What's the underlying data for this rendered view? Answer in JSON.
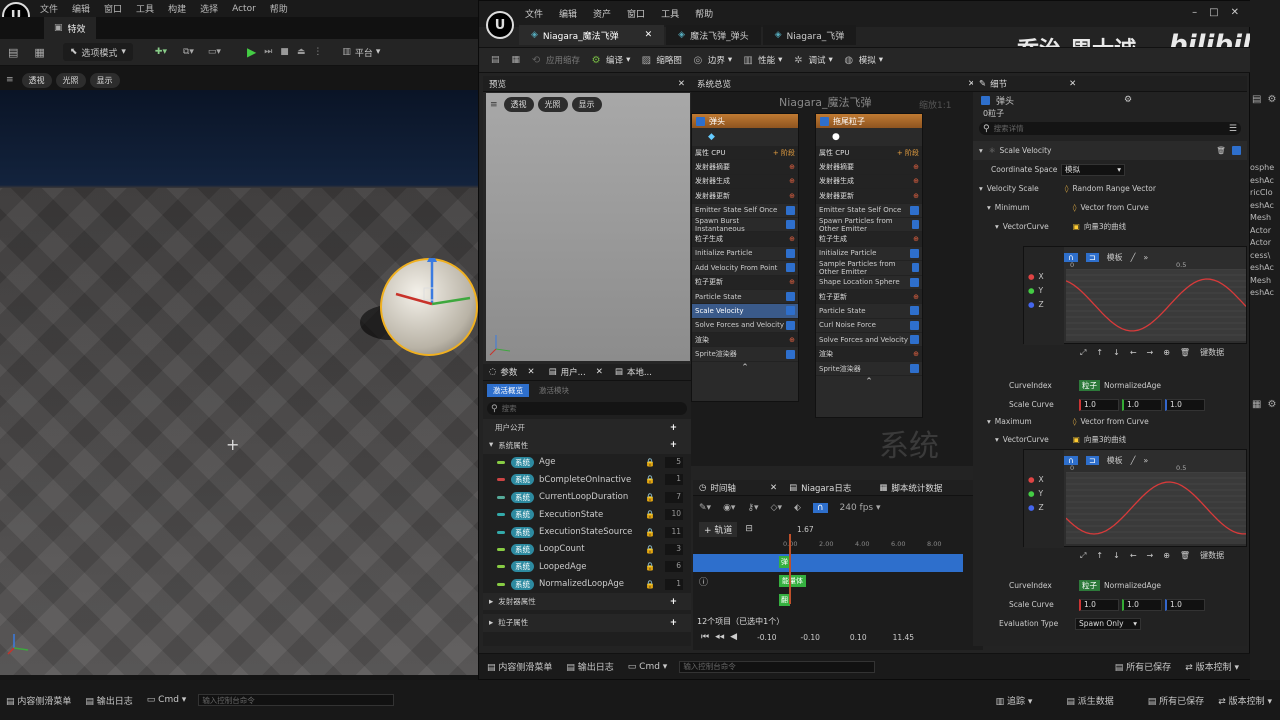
{
  "main": {
    "menu": [
      "文件",
      "编辑",
      "窗口",
      "工具",
      "构建",
      "选择",
      "Actor",
      "帮助"
    ],
    "tab": "特效",
    "select_mode": "选项模式",
    "platform": "平台",
    "viewport_buttons": [
      "透视",
      "光照",
      "显示"
    ],
    "bottom": {
      "content_drawer": "内容侧滑菜单",
      "output_log": "输出日志",
      "cmd": "Cmd",
      "console_placeholder": "输入控制台命令"
    }
  },
  "niagara": {
    "menu": [
      "文件",
      "编辑",
      "资产",
      "窗口",
      "工具",
      "帮助"
    ],
    "tabs": [
      "Niagara_魔法飞弹",
      "魔法飞弹_弹头",
      "Niagara_飞弹"
    ],
    "toolbar": [
      "应用缩存",
      "编译",
      "缩略图",
      "边界",
      "性能",
      "调试",
      "模拟"
    ],
    "watermark": "乔治-周士诚",
    "watermark_logo": "bilibili",
    "preview": {
      "title": "预览",
      "buttons": [
        "透视",
        "光照",
        "显示"
      ]
    },
    "overview": {
      "title": "系统总览",
      "system_name": "Niagara_魔法飞弹",
      "zoom": "缩放1:1",
      "big_label": "系统",
      "emitter1": {
        "name": "弹头",
        "rows": [
          {
            "t": "属性 CPU",
            "s": true,
            "r": "+ 阶段"
          },
          {
            "t": "发射器摘要",
            "s": true
          },
          {
            "t": "发射器生成",
            "s": true
          },
          {
            "t": "发射器更新",
            "s": true
          },
          {
            "t": "Emitter State  Self Once"
          },
          {
            "t": "Spawn Burst Instantaneous"
          },
          {
            "t": "粒子生成",
            "s": true
          },
          {
            "t": "Initialize Particle"
          },
          {
            "t": "Add Velocity  From Point"
          },
          {
            "t": "粒子更新",
            "s": true
          },
          {
            "t": "Particle State"
          },
          {
            "t": "Scale Velocity",
            "sel": true
          },
          {
            "t": "Solve Forces and Velocity"
          },
          {
            "t": "渲染",
            "s": true
          },
          {
            "t": "Sprite渲染器"
          }
        ]
      },
      "emitter2": {
        "name": "拖尾粒子",
        "rows": [
          {
            "t": "属性 CPU",
            "s": true,
            "r": "+ 阶段"
          },
          {
            "t": "发射器摘要",
            "s": true
          },
          {
            "t": "发射器生成",
            "s": true
          },
          {
            "t": "发射器更新",
            "s": true
          },
          {
            "t": "Emitter State  Self Once"
          },
          {
            "t": "Spawn Particles from Other Emitter"
          },
          {
            "t": "粒子生成",
            "s": true
          },
          {
            "t": "Initialize Particle"
          },
          {
            "t": "Sample Particles from Other Emitter"
          },
          {
            "t": "Shape Location  Sphere"
          },
          {
            "t": "粒子更新",
            "s": true
          },
          {
            "t": "Particle State"
          },
          {
            "t": "Curl Noise Force"
          },
          {
            "t": "Solve Forces and Velocity"
          },
          {
            "t": "渲染",
            "s": true
          },
          {
            "t": "Sprite渲染器"
          }
        ]
      }
    },
    "params": {
      "tabs": [
        "参数",
        "用户...",
        "本地..."
      ],
      "subtabs": [
        "激活概览",
        "激活模块"
      ],
      "search_placeholder": "搜索",
      "user_public": "用户公开",
      "system_attrs": "系统属性",
      "badge": "系统",
      "items": [
        {
          "name": "Age",
          "val": "5"
        },
        {
          "name": "bCompleteOnInactive",
          "val": "1"
        },
        {
          "name": "CurrentLoopDuration",
          "val": "7"
        },
        {
          "name": "ExecutionState",
          "val": "10"
        },
        {
          "name": "ExecutionStateSource",
          "val": "11"
        },
        {
          "name": "LoopCount",
          "val": "3"
        },
        {
          "name": "LoopedAge",
          "val": "6"
        },
        {
          "name": "NormalizedLoopAge",
          "val": "1"
        }
      ],
      "emitter_attrs": "发射器属性",
      "particle_attrs": "粒子属性"
    },
    "timeline": {
      "tabs": [
        "时间轴",
        "Niagara日志",
        "脚本统计数据"
      ],
      "fps": "240 fps",
      "track_btn": "+ 轨道",
      "ticks": [
        "0.00",
        "2.00",
        "4.00",
        "6.00",
        "8.00"
      ],
      "current": "1.67",
      "item_count": "12个项目（已选中1个）",
      "track_labels": [
        "弹",
        "能量体",
        "翻"
      ],
      "range": [
        "-0.10",
        "-0.10",
        "0.10",
        "11.45"
      ]
    },
    "details": {
      "title": "细节",
      "emitter": "弹头",
      "sub": "0粒子",
      "search_placeholder": "搜索详情",
      "module": "Scale Velocity",
      "coordinate_space_label": "Coordinate Space",
      "coordinate_space_value": "模拟",
      "velocity_scale_label": "Velocity Scale",
      "velocity_scale_value": "Random Range Vector",
      "minimum_label": "Minimum",
      "minimum_value": "Vector from Curve",
      "vector_curve_label": "VectorCurve",
      "vector_curve_value": "向量3的曲线",
      "template": "模板",
      "axes": [
        "X",
        "Y",
        "Z"
      ],
      "curve_ticks_x": [
        "0",
        "0.5"
      ],
      "key_data": "键数据",
      "curve_index_label": "CurveIndex",
      "curve_index_badge": "粒子",
      "curve_index_value": "NormalizedAge",
      "scale_curve_label": "Scale Curve",
      "scale_curve_values": [
        "1.0",
        "1.0",
        "1.0"
      ],
      "maximum_label": "Maximum",
      "maximum_value": "Vector from Curve",
      "evaluation_label": "Evaluation Type",
      "evaluation_value": "Spawn Only"
    },
    "bottom": {
      "content_drawer": "内容侧滑菜单",
      "output_log": "输出日志",
      "cmd": "Cmd",
      "console_placeholder": "输入控制台命令",
      "all_saved": "所有已保存",
      "version": "版本控制"
    }
  },
  "status": {
    "trace": "追踪",
    "derived": "派生数据",
    "all_saved": "所有已保存",
    "version": "版本控制"
  },
  "right_sliver": [
    "osphe",
    "eshAc",
    "ricClo",
    "eshAc",
    "Mesh",
    "Actor",
    "Actor",
    "cess\\",
    "eshAc",
    "Mesh",
    "eshAc"
  ],
  "colors": {
    "accent": "#2e6fcc",
    "emitter": "#b86e2a",
    "selection": "#f0b020",
    "curve": "#d83a3a"
  }
}
